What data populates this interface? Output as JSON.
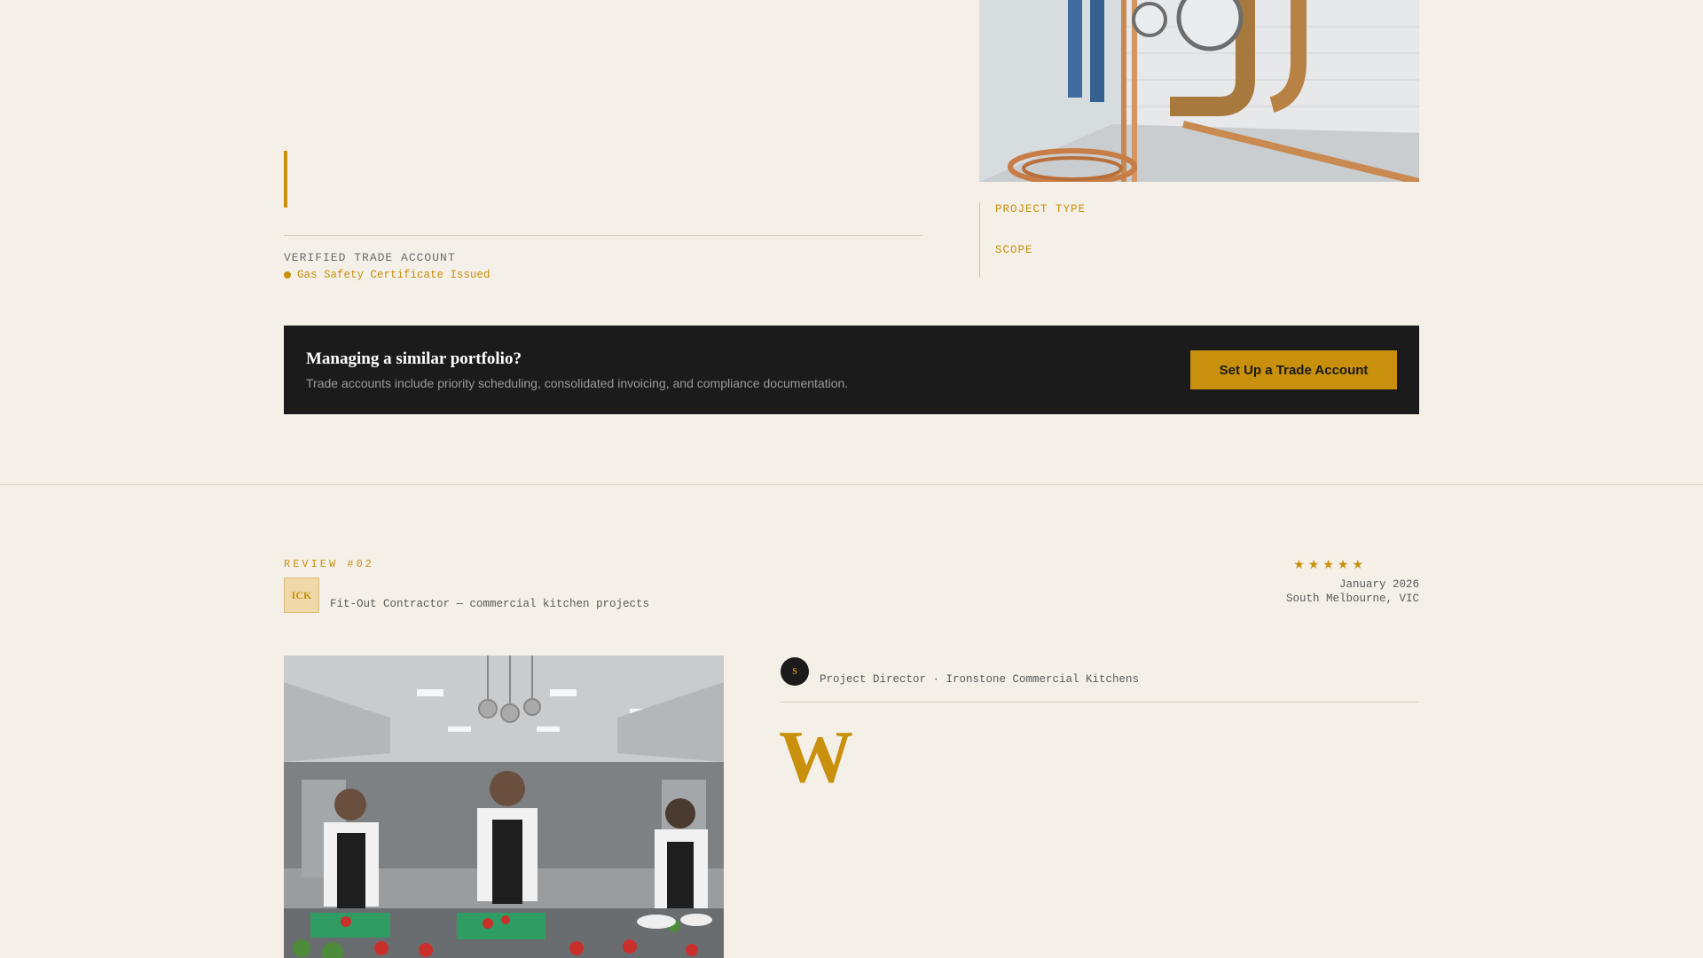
{
  "review_one": {
    "verified_label": "VERIFIED TRADE ACCOUNT",
    "certificate": "Gas Safety Certificate Issued",
    "meta_labels": [
      "PROJECT TYPE",
      "SCOPE"
    ]
  },
  "cta": {
    "title": "Managing a similar portfolio?",
    "subtitle": "Trade accounts include priority scheduling, consolidated invoicing, and compliance documentation.",
    "button_label": "Set Up a Trade Account"
  },
  "review_two": {
    "number_label": "REVIEW #02",
    "badge": "ICK",
    "company_description": "Fit-Out Contractor — commercial kitchen projects",
    "rating": 5,
    "stars": [
      "★",
      "★",
      "★",
      "★",
      "★"
    ],
    "date": "January 2026",
    "location": "South Melbourne, VIC",
    "avatar_initial": "S",
    "reviewer": "Project Director · Ironstone Commercial Kitchens",
    "dropcap": "W"
  },
  "colors": {
    "background": "#f4f0e8",
    "accent": "#c8900c",
    "dark": "#1b1b1b"
  },
  "icons": [
    "status-dot-icon",
    "star-icon"
  ]
}
